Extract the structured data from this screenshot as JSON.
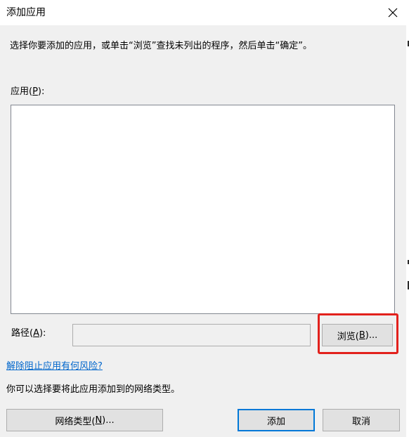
{
  "window": {
    "title": "添加应用",
    "close_icon": "close-icon"
  },
  "instructions": "选择你要添加的应用，或单击“浏览”查找未列出的程序，然后单击“确定”。",
  "apps_field": {
    "label": "应用(",
    "accelerator": "P",
    "label_suffix": "):",
    "items": []
  },
  "path_field": {
    "label": "路径(",
    "accelerator": "A",
    "label_suffix": "):",
    "value": ""
  },
  "browse_button": {
    "label": "浏览(",
    "accelerator": "B",
    "label_suffix": ")..."
  },
  "risk_link": "解除阻止应用有何风险?",
  "network_note": "你可以选择要将此应用添加到的网络类型。",
  "network_types_button": {
    "label": "网络类型(",
    "accelerator": "N",
    "label_suffix": ")..."
  },
  "add_button": "添加",
  "cancel_button": "取消",
  "colors": {
    "highlight_border": "#e2211c",
    "link": "#0066cc",
    "default_button_border": "#0078d7",
    "dialog_background": "#f0f0f0"
  }
}
